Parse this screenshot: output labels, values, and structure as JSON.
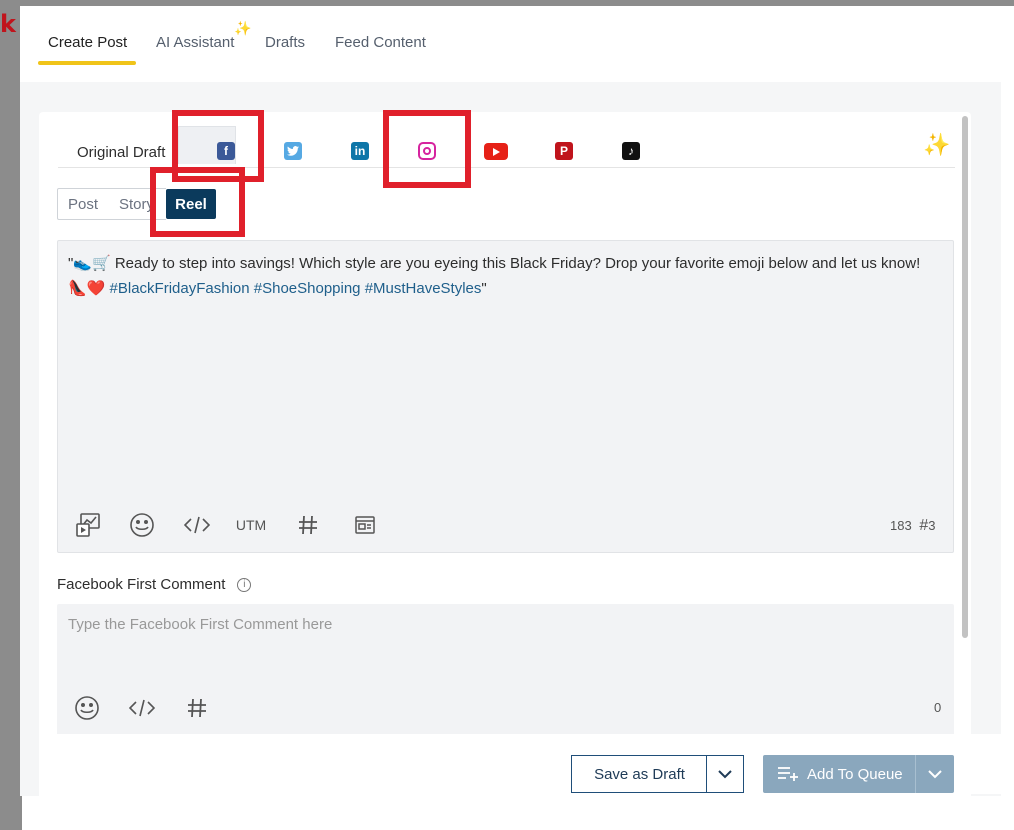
{
  "tabs": [
    {
      "label": "Create Post",
      "active": true
    },
    {
      "label": "AI Assistant",
      "active": false
    },
    {
      "label": "Drafts",
      "active": false
    },
    {
      "label": "Feed Content",
      "active": false
    }
  ],
  "networks": {
    "original_draft_label": "Original Draft",
    "items": [
      "facebook-icon",
      "twitter-icon",
      "linkedin-icon",
      "instagram-icon",
      "youtube-icon",
      "pinterest-icon",
      "tiktok-icon"
    ]
  },
  "post_types": [
    "Post",
    "Story",
    "Reel"
  ],
  "selected_post_type": "Reel",
  "editor": {
    "text_prefix": "\"👟🛒 Ready to step into savings! Which style are you eyeing this Black Friday? Drop your favorite emoji below and let us know! 👠❤️ ",
    "hashtags": "#BlackFridayFashion #ShoeShopping #MustHaveStyles",
    "text_suffix": "\"",
    "utm_label": "UTM",
    "char_count": "183",
    "hashtag_count": "3"
  },
  "first_comment": {
    "label": "Facebook First Comment",
    "placeholder": "Type the Facebook First Comment here",
    "char_count": "0"
  },
  "buttons": {
    "save_draft": "Save as Draft",
    "add_to_queue": "Add To Queue"
  },
  "colors": {
    "accent_underline": "#f0c419",
    "reel_active": "#0b3a5c",
    "highlight": "#e0202b",
    "queue_button": "#8aa7bd"
  }
}
